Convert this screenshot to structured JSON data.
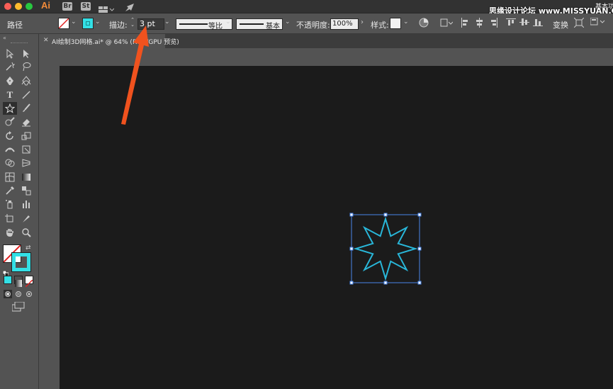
{
  "titlebar": {
    "app_name": "Ai",
    "bridge_label": "Br",
    "stock_label": "St",
    "workspace_label": "基本功",
    "watermark": "思缘设计论坛 www.MISSYUAN.COM"
  },
  "controlbar": {
    "selection_label": "路径",
    "stroke_label": "描边:",
    "stroke_value": "3 pt",
    "profile_label": "等比",
    "brush_label": "基本",
    "opacity_label": "不透明度:",
    "opacity_value": "100%",
    "style_label": "样式:",
    "transform_label": "变换"
  },
  "document": {
    "tab_title": "AI绘制3D网格.ai* @ 64% (RGB/GPU 预览)"
  },
  "colors": {
    "accent_fill": "#33e0e6",
    "selection_blue": "#4a86e8",
    "star_stroke": "#29b7d9",
    "arrow": "#f0521e",
    "artboard": "#1b1b1b"
  },
  "icons": [
    "selection-tool-icon",
    "direct-selection-tool-icon",
    "magic-wand-icon",
    "lasso-icon",
    "pen-icon",
    "curvature-icon",
    "type-icon",
    "line-icon",
    "star-icon",
    "paintbrush-icon",
    "shaper-icon",
    "eraser-icon",
    "rotate-icon",
    "scale-icon",
    "width-icon",
    "free-transform-icon",
    "shape-builder-icon",
    "perspective-icon",
    "mesh-icon",
    "gradient-icon",
    "eyedropper-icon",
    "blend-icon",
    "symbol-sprayer-icon",
    "graph-icon",
    "artboard-icon",
    "slice-icon",
    "hand-icon",
    "zoom-icon"
  ]
}
